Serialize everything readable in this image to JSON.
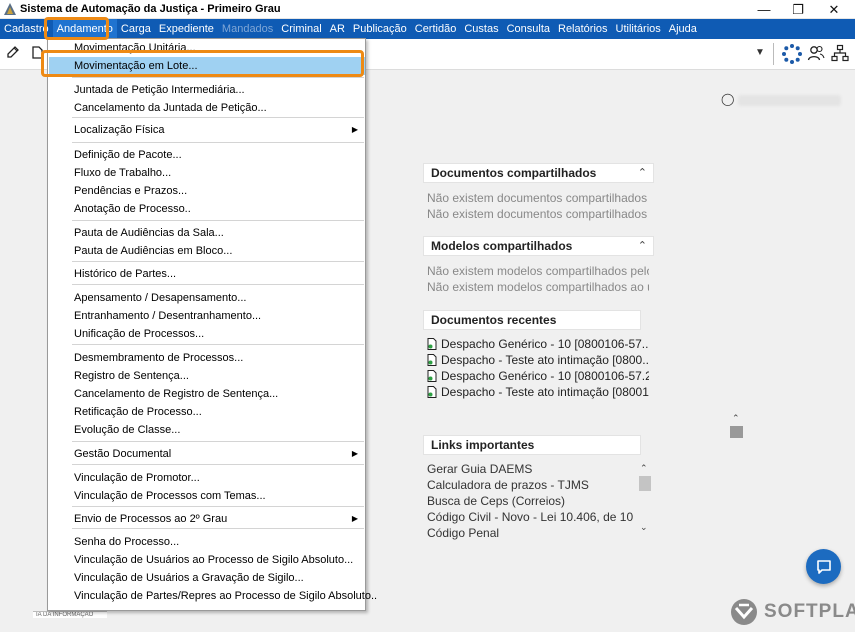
{
  "window": {
    "title": "Sistema de Automação da Justiça - Primeiro Grau",
    "controls": [
      "minimize-icon",
      "maximize-icon",
      "close-icon"
    ]
  },
  "menu": [
    "Cadastro",
    "Andamento",
    "Carga",
    "Expediente",
    "Mandados",
    "Criminal",
    "AR",
    "Publicação",
    "Certidão",
    "Custas",
    "Consulta",
    "Relatórios",
    "Utilitários",
    "Ajuda"
  ],
  "menu_disabled": [
    "Mandados"
  ],
  "menu_active": "Andamento",
  "dropdown": {
    "items": [
      {
        "label": "Movimentação Unitária...",
        "submenu": false
      },
      {
        "label": "Movimentação em Lote...",
        "submenu": false,
        "highlighted": true
      },
      {
        "label": "Juntada de Petição Intermediária...",
        "submenu": false
      },
      {
        "label": "Cancelamento da Juntada de Petição...",
        "submenu": false
      },
      {
        "label": "Localização Física",
        "submenu": true
      },
      {
        "label": "Definição de Pacote...",
        "submenu": false
      },
      {
        "label": "Fluxo de Trabalho...",
        "submenu": false
      },
      {
        "label": "Pendências e Prazos...",
        "submenu": false
      },
      {
        "label": "Anotação de Processo..",
        "submenu": false
      },
      {
        "label": "Pauta de Audiências da Sala...",
        "submenu": false
      },
      {
        "label": "Pauta de Audiências em Bloco...",
        "submenu": false
      },
      {
        "label": "Histórico de Partes...",
        "submenu": false
      },
      {
        "label": "Apensamento / Desapensamento...",
        "submenu": false
      },
      {
        "label": "Entranhamento / Desentranhamento...",
        "submenu": false
      },
      {
        "label": "Unificação de Processos...",
        "submenu": false
      },
      {
        "label": "Desmembramento de Processos...",
        "submenu": false
      },
      {
        "label": "Registro de Sentença...",
        "submenu": false
      },
      {
        "label": "Cancelamento de Registro de Sentença...",
        "submenu": false
      },
      {
        "label": "Retificação de Processo...",
        "submenu": false
      },
      {
        "label": "Evolução de Classe...",
        "submenu": false
      },
      {
        "label": "Gestão Documental",
        "submenu": true
      },
      {
        "label": "Vinculação de Promotor...",
        "submenu": false
      },
      {
        "label": "Vinculação de Processos com Temas...",
        "submenu": false
      },
      {
        "label": "Envio de Processos ao 2º Grau",
        "submenu": true
      },
      {
        "label": "Senha do Processo...",
        "submenu": false
      },
      {
        "label": "Vinculação de Usuários ao Processo de Sigilo Absoluto...",
        "submenu": false
      },
      {
        "label": "Vinculação de Usuários a Gravação de Sigilo...",
        "submenu": false
      },
      {
        "label": "Vinculação de Partes/Repres ao Processo de Sigilo Absoluto..",
        "submenu": false
      }
    ]
  },
  "panels": {
    "shared_docs": {
      "title": "Documentos compartilhados",
      "items": [
        "Não existem documentos compartilhados ...",
        "Não existem documentos compartilhados ..."
      ]
    },
    "shared_models": {
      "title": "Modelos compartilhados",
      "items": [
        "Não existem modelos compartilhados pelo",
        "Não existem modelos compartilhados ao u"
      ]
    },
    "recent_docs": {
      "title": "Documentos recentes",
      "items": [
        "Despacho Genérico - 10 [0800106-57....",
        "Despacho - Teste ato intimação [0800...",
        "Despacho Genérico - 10 [0800106-57.202",
        "Despacho - Teste ato intimação [080010.."
      ]
    },
    "links": {
      "title": "Links importantes",
      "items": [
        "Gerar Guia DAEMS",
        "Calculadora de prazos - TJMS",
        "Busca de Ceps (Correios)",
        "Código Civil - Novo - Lei 10.406, de 10/...",
        "Código Penal"
      ]
    }
  },
  "brand": "SOFTPLAN",
  "footer_text": "IA DA INFORMAÇÃO",
  "colors": {
    "menubar": "#0f5bb4",
    "highlight": "#9fd1f2",
    "annotation": "#ee8a14",
    "chat": "#1c6bc0"
  }
}
